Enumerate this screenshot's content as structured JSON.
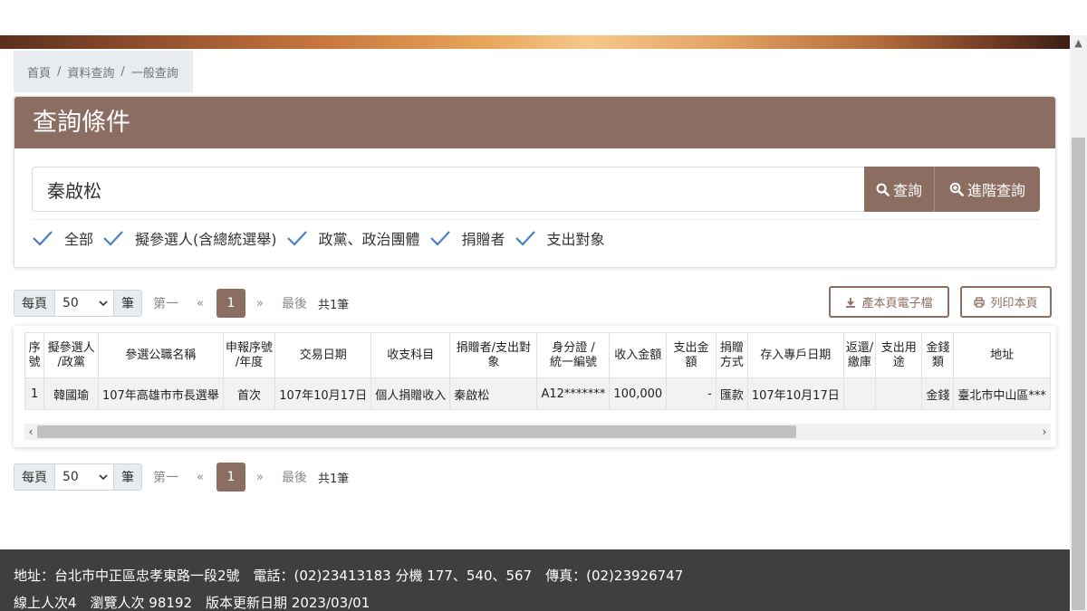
{
  "breadcrumb": {
    "home": "首頁",
    "data_query": "資料查詢",
    "general_query": "一般查詢",
    "separator": "/"
  },
  "query": {
    "title": "查詢條件",
    "search_value": "秦啟松",
    "search_button": "查詢",
    "advanced_button": "進階查詢",
    "filters": [
      {
        "label": "全部",
        "checked": true
      },
      {
        "label": "擬參選人(含總統選舉)",
        "checked": true
      },
      {
        "label": "政黨、政治團體",
        "checked": true
      },
      {
        "label": "捐贈者",
        "checked": true
      },
      {
        "label": "支出對象",
        "checked": true
      }
    ]
  },
  "pager": {
    "per_page_label": "每頁",
    "per_page_value": "50",
    "unit_label": "筆",
    "first": "第一",
    "prev": "«",
    "current": "1",
    "next": "»",
    "last": "最後",
    "total": "共1筆"
  },
  "actions": {
    "export": "產本頁電子檔",
    "print": "列印本頁"
  },
  "table": {
    "headers": [
      "序號",
      "擬參選人/政黨",
      "參選公職名稱",
      "申報序號/年度",
      "交易日期",
      "收支科目",
      "捐贈者/支出對象",
      "身分證 / 統一編號",
      "收入金額",
      "支出金額",
      "捐贈方式",
      "存入專戶日期",
      "返還/繳庫",
      "支出用途",
      "金錢類",
      "地址"
    ],
    "rows": [
      [
        "1",
        "韓國瑜",
        "107年高雄市市長選舉",
        "首次",
        "107年10月17日",
        "個人捐贈收入",
        "秦啟松",
        "A12*******",
        "100,000",
        "-",
        "匯款",
        "107年10月17日",
        "",
        "",
        "金錢",
        "臺北市中山區***"
      ]
    ]
  },
  "footer": {
    "line1": "地址：台北市中正區忠孝東路一段2號　電話：(02)23413183 分機 177、540、567　傳真：(02)23926747",
    "line2": "線上人次4　瀏覽人次 98192　版本更新日期 2023/03/01"
  },
  "colors": {
    "brand": "#8c6d62",
    "check": "#4a7fc1",
    "footer_bg": "#3f3f3f"
  }
}
